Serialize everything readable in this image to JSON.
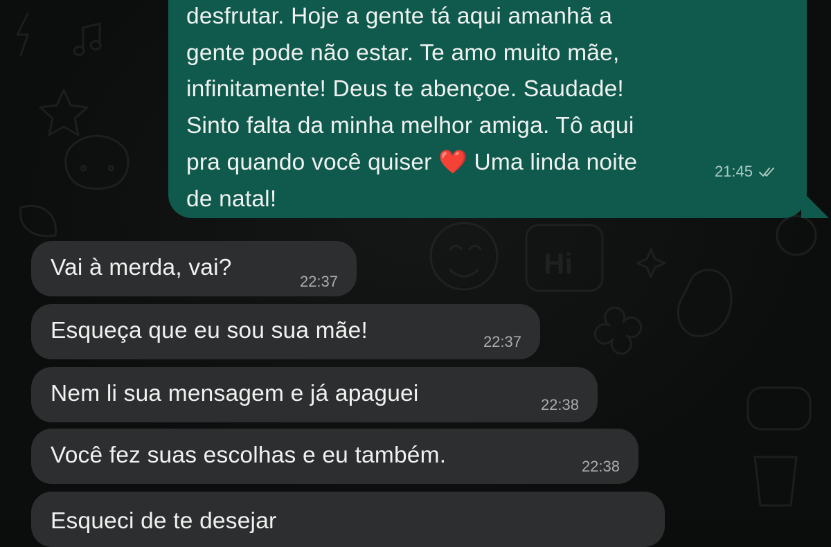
{
  "chat": {
    "outgoing": {
      "text": "desfrutar. Hoje a gente tá aqui amanhã a\ngente pode não estar. Te amo muito mãe,\ninfinitamente! Deus te abençoe. Saudade!\nSinto falta da minha melhor amiga. Tô aqui\npra quando você quiser",
      "heart": "❤️",
      "text_after": " Uma linda noite\nde natal!",
      "time": "21:45",
      "status_icon": "double-check-icon"
    },
    "incoming": [
      {
        "text": "Vai à merda, vai?",
        "time": "22:37"
      },
      {
        "text": "Esqueça que eu sou sua mãe!",
        "time": "22:37"
      },
      {
        "text": "Nem li sua mensagem e já apaguei",
        "time": "22:38"
      },
      {
        "text": "Você fez suas escolhas e eu também.",
        "time": "22:38"
      },
      {
        "text": "Esqueci de te desejar",
        "time": ""
      }
    ]
  },
  "colors": {
    "background": "#0b0c0c",
    "outgoing_bubble": "#0f5a4d",
    "incoming_bubble": "#2c2e2f",
    "heart": "#e0212f"
  }
}
